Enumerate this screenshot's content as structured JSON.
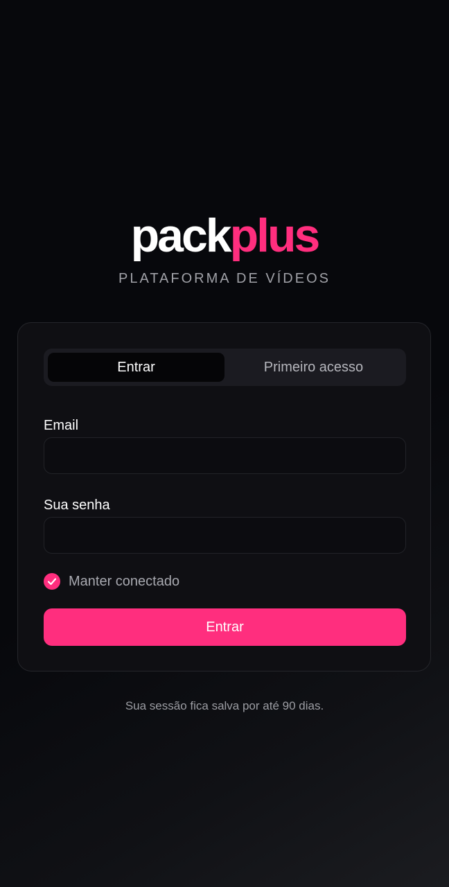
{
  "brand": {
    "logo_primary": "pack",
    "logo_accent": "plus",
    "tagline": "PLATAFORMA DE VÍDEOS"
  },
  "tabs": [
    {
      "label": "Entrar",
      "active": true
    },
    {
      "label": "Primeiro acesso",
      "active": false
    }
  ],
  "form": {
    "email_label": "Email",
    "email_value": "",
    "password_label": "Sua senha",
    "password_value": "",
    "remember_label": "Manter conectado",
    "remember_checked": true,
    "submit_label": "Entrar"
  },
  "footer": {
    "note": "Sua sessão fica salva por até 90 dias."
  },
  "colors": {
    "accent": "#ff2e7e",
    "background": "#07080c",
    "card": "#0f0f13"
  },
  "icons": {
    "checkbox": "check-icon"
  }
}
